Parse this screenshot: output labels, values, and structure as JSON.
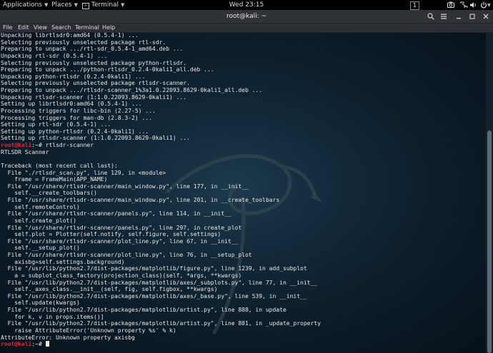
{
  "panel": {
    "applications_label": "Applications",
    "places_label": "Places",
    "terminal_label": "Terminal",
    "clock": "Wed 23:15",
    "workspace_number": "1"
  },
  "window": {
    "title": "root@kali: ~"
  },
  "menu": {
    "file": "File",
    "edit": "Edit",
    "view": "View",
    "search": "Search",
    "terminal": "Terminal",
    "help": "Help"
  },
  "terminal": {
    "lines": [
      {
        "prompt": "",
        "text": "Unpacking librtlsdr0:amd64 (0.5.4-1) ..."
      },
      {
        "prompt": "",
        "text": "Selecting previously unselected package rtl-sdr."
      },
      {
        "prompt": "",
        "text": "Preparing to unpack .../rtl-sdr_0.5.4-1_amd64.deb ..."
      },
      {
        "prompt": "",
        "text": "Unpacking rtl-sdr (0.5.4-1) ..."
      },
      {
        "prompt": "",
        "text": "Selecting previously unselected package python-rtlsdr."
      },
      {
        "prompt": "",
        "text": "Preparing to unpack .../python-rtlsdr_0.2.4-0kali1_all.deb ..."
      },
      {
        "prompt": "",
        "text": "Unpacking python-rtlsdr (0.2.4-0kali1) ..."
      },
      {
        "prompt": "",
        "text": "Selecting previously unselected package rtlsdr-scanner."
      },
      {
        "prompt": "",
        "text": "Preparing to unpack .../rtlsdr-scanner_1%3a1.0.22093.8629-0kali1_all.deb ..."
      },
      {
        "prompt": "",
        "text": "Unpacking rtlsdr-scanner (1:1.0.22093.8629-0kali1) ..."
      },
      {
        "prompt": "",
        "text": "Setting up librtlsdr0:amd64 (0.5.4-1) ..."
      },
      {
        "prompt": "",
        "text": "Processing triggers for libc-bin (2.27-5) ..."
      },
      {
        "prompt": "",
        "text": "Processing triggers for man-db (2.8.3-2) ..."
      },
      {
        "prompt": "",
        "text": "Setting up rtl-sdr (0.5.4-1) ..."
      },
      {
        "prompt": "",
        "text": "Setting up python-rtlsdr (0.2.4-0kali1) ..."
      },
      {
        "prompt": "",
        "text": "Setting up rtlsdr-scanner (1:1.0.22093.8629-0kali1) ..."
      },
      {
        "prompt": "root@kali",
        "text": ":~# rtlsdr-scanner"
      },
      {
        "prompt": "",
        "text": "RTLSDR Scanner"
      },
      {
        "prompt": "",
        "text": ""
      },
      {
        "prompt": "",
        "text": "Traceback (most recent call last):"
      },
      {
        "prompt": "",
        "text": "  File \"./rtlsdr_scan.py\", line 129, in <module>"
      },
      {
        "prompt": "",
        "text": "    frame = FrameMain(APP_NAME)"
      },
      {
        "prompt": "",
        "text": "  File \"/usr/share/rtlsdr-scanner/main_window.py\", line 177, in __init__"
      },
      {
        "prompt": "",
        "text": "    self.__create_toolbars()"
      },
      {
        "prompt": "",
        "text": "  File \"/usr/share/rtlsdr-scanner/main_window.py\", line 201, in __create_toolbars"
      },
      {
        "prompt": "",
        "text": "    self.remoteControl)"
      },
      {
        "prompt": "",
        "text": "  File \"/usr/share/rtlsdr-scanner/panels.py\", line 114, in __init__"
      },
      {
        "prompt": "",
        "text": "    self.create_plot()"
      },
      {
        "prompt": "",
        "text": "  File \"/usr/share/rtlsdr-scanner/panels.py\", line 297, in create_plot"
      },
      {
        "prompt": "",
        "text": "    self.plot = Plotter(self.notify, self.figure, self.settings)"
      },
      {
        "prompt": "",
        "text": "  File \"/usr/share/rtlsdr-scanner/plot_line.py\", line 67, in __init__"
      },
      {
        "prompt": "",
        "text": "    self.__setup_plot()"
      },
      {
        "prompt": "",
        "text": "  File \"/usr/share/rtlsdr-scanner/plot_line.py\", line 76, in __setup_plot"
      },
      {
        "prompt": "",
        "text": "    axisbg=self.settings.background)"
      },
      {
        "prompt": "",
        "text": "  File \"/usr/lib/python2.7/dist-packages/matplotlib/figure.py\", line 1239, in add_subplot"
      },
      {
        "prompt": "",
        "text": "    a = subplot_class_factory(projection_class)(self, *args, **kwargs)"
      },
      {
        "prompt": "",
        "text": "  File \"/usr/lib/python2.7/dist-packages/matplotlib/axes/_subplots.py\", line 77, in __init__"
      },
      {
        "prompt": "",
        "text": "    self._axes_class.__init__(self, fig, self.figbox, **kwargs)"
      },
      {
        "prompt": "",
        "text": "  File \"/usr/lib/python2.7/dist-packages/matplotlib/axes/_base.py\", line 539, in __init__"
      },
      {
        "prompt": "",
        "text": "    self.update(kwargs)"
      },
      {
        "prompt": "",
        "text": "  File \"/usr/lib/python2.7/dist-packages/matplotlib/artist.py\", line 888, in update"
      },
      {
        "prompt": "",
        "text": "    for k, v in props.items()]"
      },
      {
        "prompt": "",
        "text": "  File \"/usr/lib/python2.7/dist-packages/matplotlib/artist.py\", line 881, in _update_property"
      },
      {
        "prompt": "",
        "text": "    raise AttributeError('Unknown property %s' % k)"
      },
      {
        "prompt": "",
        "text": "AttributeError: Unknown property axisbg"
      },
      {
        "prompt": "root@kali",
        "text": ":~# ",
        "cursor": true
      }
    ]
  },
  "icons": {
    "terminal_app": "terminal-icon",
    "camera": "camera-icon",
    "network": "network-icon",
    "volume": "volume-icon",
    "power": "power-icon",
    "search": "search-icon",
    "menu": "hamburger-menu-icon",
    "minimize": "minimize-icon",
    "maximize": "maximize-icon",
    "close": "close-icon"
  },
  "colors": {
    "prompt": "#e0243a",
    "terminal_text": "#e8e8e8",
    "terminal_bg": "#0b1b27"
  }
}
